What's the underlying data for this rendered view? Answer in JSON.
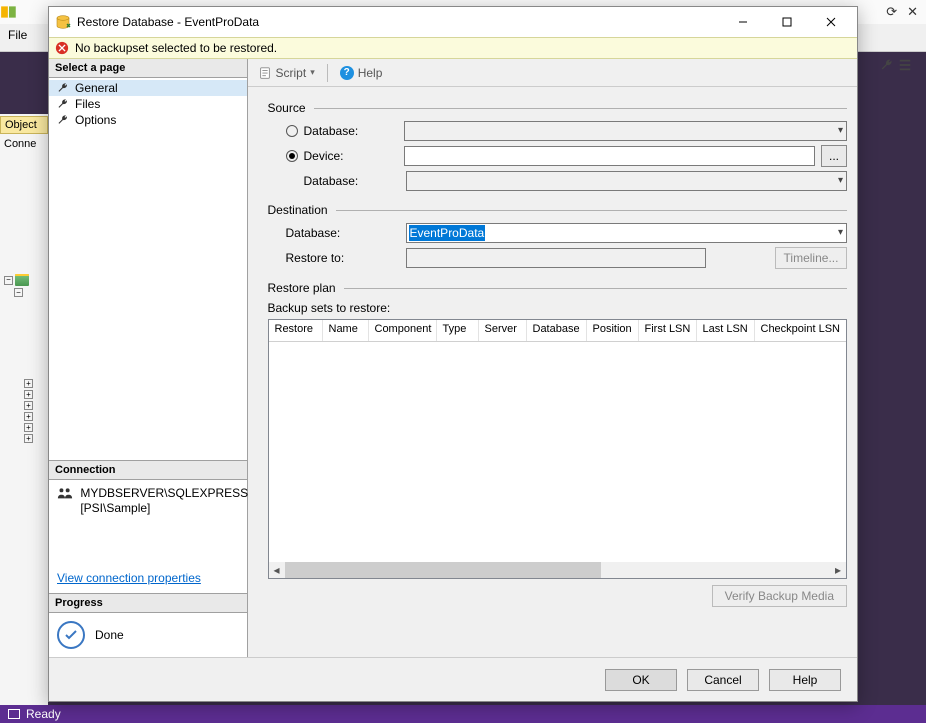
{
  "ssms": {
    "file_menu": "File",
    "side": {
      "object": "Object",
      "conne": "Conne"
    },
    "status": "Ready",
    "right_icons": {
      "restore": "⟳",
      "close": "✕"
    }
  },
  "dialog": {
    "title": "Restore Database - EventProData",
    "warning": "No backupset selected to be restored.",
    "pages_header": "Select a page",
    "pages": {
      "general": "General",
      "files": "Files",
      "options": "Options"
    },
    "connection_header": "Connection",
    "connection_server": "MYDBSERVER\\SQLEXPRESS",
    "connection_user": "[PSI\\Sample]",
    "connection_link": "View connection properties",
    "progress_header": "Progress",
    "progress_text": "Done",
    "toolbar": {
      "script": "Script",
      "help": "Help"
    },
    "source": {
      "title": "Source",
      "database": "Database:",
      "device": "Device:",
      "device_db": "Database:",
      "ellipsis": "..."
    },
    "destination": {
      "title": "Destination",
      "database": "Database:",
      "database_value": "EventProData",
      "restore_to": "Restore to:",
      "timeline": "Timeline..."
    },
    "plan": {
      "title": "Restore plan",
      "label": "Backup sets to restore:",
      "cols": {
        "restore": "Restore",
        "name": "Name",
        "component": "Component",
        "type": "Type",
        "server": "Server",
        "database": "Database",
        "position": "Position",
        "first_lsn": "First LSN",
        "last_lsn": "Last LSN",
        "checkpoint_lsn": "Checkpoint LSN"
      },
      "verify": "Verify Backup Media"
    },
    "buttons": {
      "ok": "OK",
      "cancel": "Cancel",
      "help": "Help"
    }
  }
}
